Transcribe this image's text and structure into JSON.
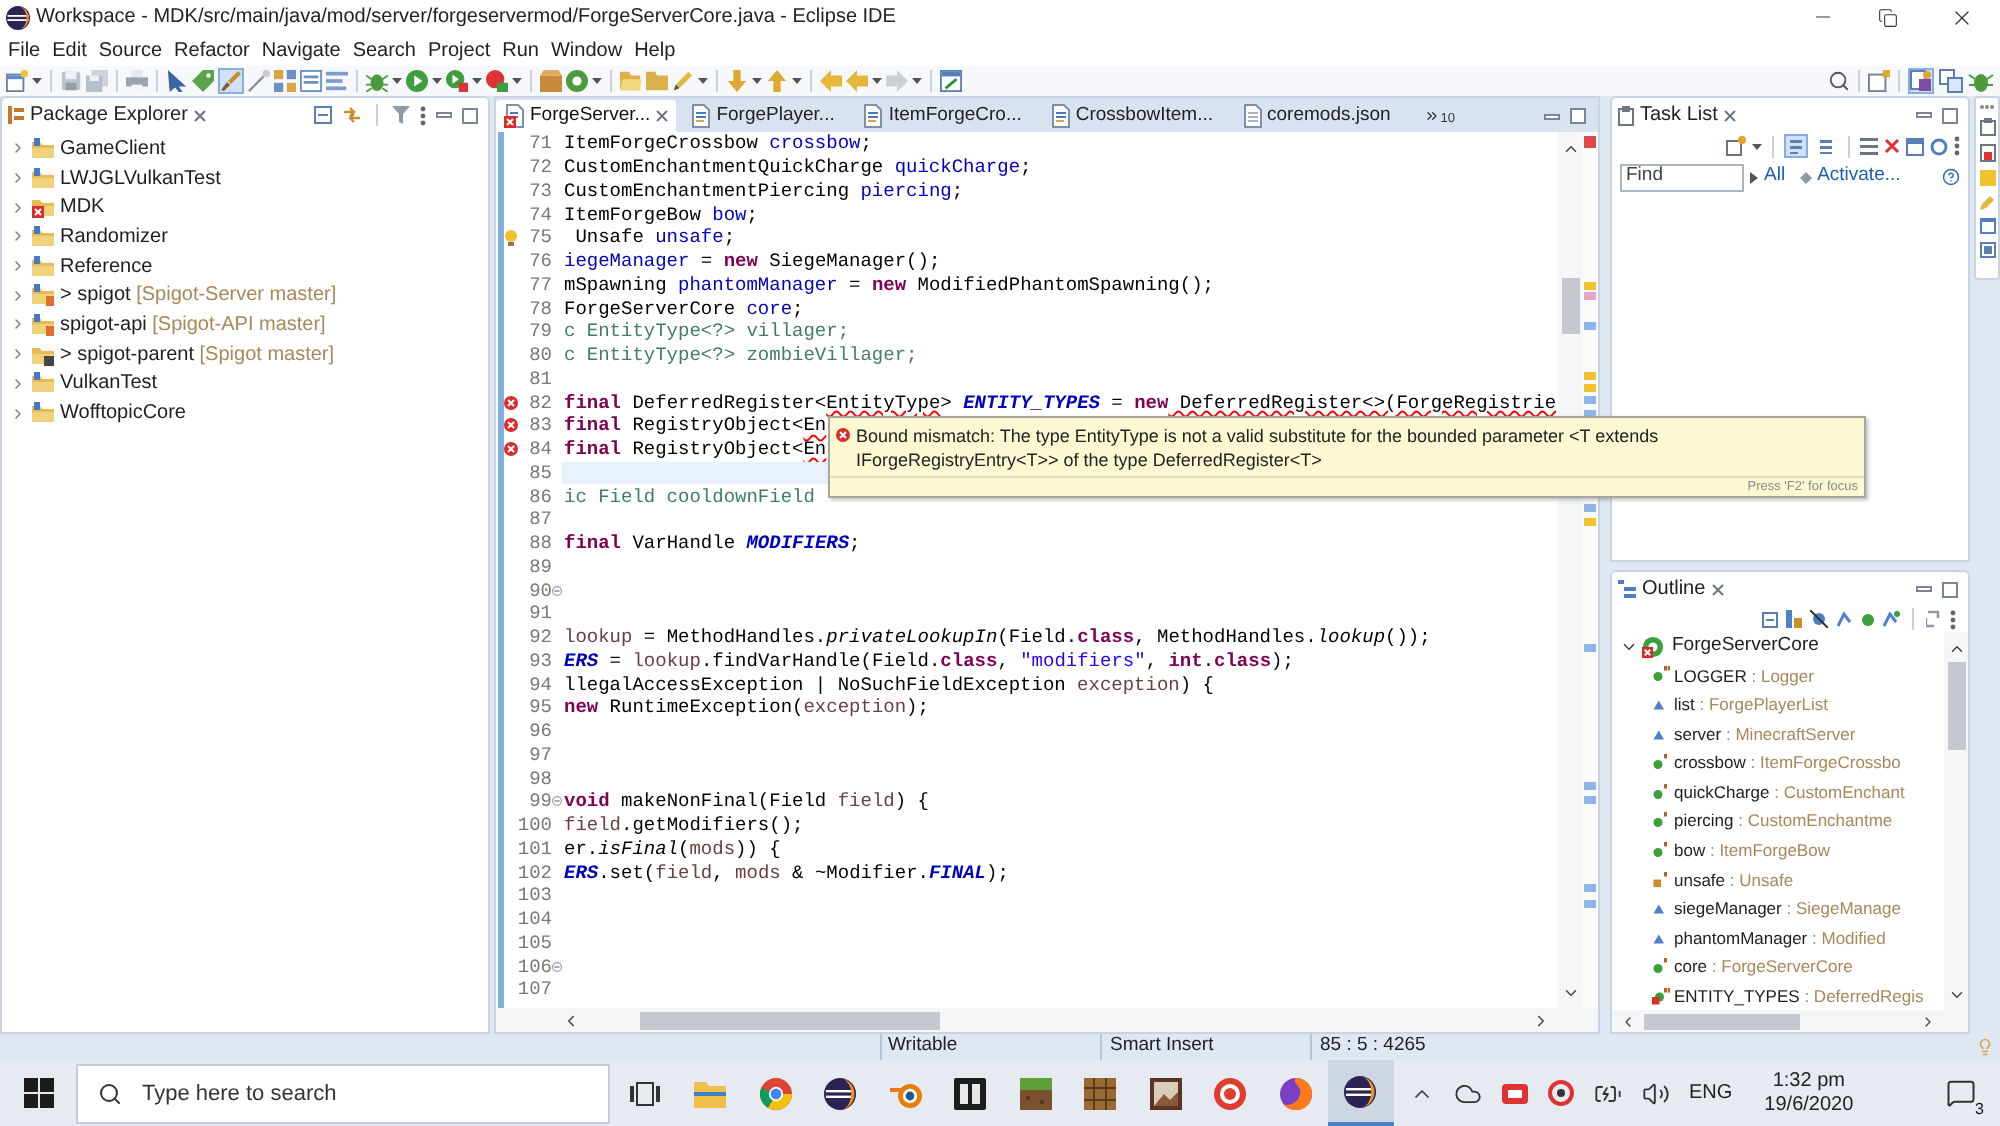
{
  "window": {
    "title": "Workspace - MDK/src/main/java/mod/server/forgeservermod/ForgeServerCore.java - Eclipse IDE"
  },
  "menu": [
    "File",
    "Edit",
    "Source",
    "Refactor",
    "Navigate",
    "Search",
    "Project",
    "Run",
    "Window",
    "Help"
  ],
  "toolbar": {
    "mark_occurrences": {
      "selected": true
    },
    "perspectives": [
      {
        "kind": "java",
        "selected": true
      },
      {
        "kind": "team",
        "selected": false
      },
      {
        "kind": "debug",
        "selected": false
      }
    ]
  },
  "package_explorer": {
    "title": "Package Explorer",
    "items": [
      {
        "name": "GameClient",
        "kind": "project",
        "expanded": false
      },
      {
        "name": "LWJGLVulkanTest",
        "kind": "project",
        "expanded": false
      },
      {
        "name": "MDK",
        "kind": "project-error",
        "expanded": false
      },
      {
        "name": "Randomizer",
        "kind": "project",
        "expanded": false
      },
      {
        "name": "Reference",
        "kind": "project",
        "expanded": false
      },
      {
        "name": "> spigot",
        "repo": "[Spigot-Server master]",
        "kind": "git-project",
        "expanded": false
      },
      {
        "name": "spigot-api",
        "repo": "[Spigot-API master]",
        "kind": "git-project",
        "expanded": false
      },
      {
        "name": "> spigot-parent",
        "repo": "[Spigot master]",
        "kind": "git-folder",
        "expanded": false
      },
      {
        "name": "VulkanTest",
        "kind": "project",
        "expanded": false
      },
      {
        "name": "WofftopicCore",
        "kind": "project",
        "expanded": false
      }
    ]
  },
  "editor": {
    "tabs": [
      {
        "label": "ForgeServer...",
        "kind": "java-error",
        "selected": true
      },
      {
        "label": "ForgePlayer...",
        "kind": "java",
        "selected": false
      },
      {
        "label": "ItemForgeCro...",
        "kind": "java",
        "selected": false
      },
      {
        "label": "CrossbowItem...",
        "kind": "java",
        "selected": false
      },
      {
        "label": "coremods.json",
        "kind": "json",
        "selected": false
      }
    ],
    "hidden_tabs": "10",
    "lines": [
      {
        "number": "71",
        "kind": "code",
        "current": false,
        "segments": [
          {
            "kind": "plain",
            "text": "ItemForgeCrossbow "
          },
          {
            "kind": "field",
            "text": "crossbow"
          },
          {
            "kind": "plain",
            "text": ";"
          }
        ]
      },
      {
        "number": "72",
        "kind": "code",
        "current": false,
        "segments": [
          {
            "kind": "plain",
            "text": "CustomEnchantmentQuickCharge "
          },
          {
            "kind": "field",
            "text": "quickCharge"
          },
          {
            "kind": "plain",
            "text": ";"
          }
        ]
      },
      {
        "number": "73",
        "kind": "code",
        "current": false,
        "segments": [
          {
            "kind": "plain",
            "text": "CustomEnchantmentPiercing "
          },
          {
            "kind": "field",
            "text": "piercing"
          },
          {
            "kind": "plain",
            "text": ";"
          }
        ]
      },
      {
        "number": "74",
        "kind": "code",
        "current": false,
        "segments": [
          {
            "kind": "plain",
            "text": "ItemForgeBow "
          },
          {
            "kind": "field",
            "text": "bow"
          },
          {
            "kind": "plain",
            "text": ";"
          }
        ]
      },
      {
        "number": "75",
        "kind": "warning",
        "current": false,
        "segments": [
          {
            "kind": "plain",
            "text": " Unsafe "
          },
          {
            "kind": "field",
            "text": "unsafe"
          },
          {
            "kind": "plain",
            "text": ";"
          }
        ]
      },
      {
        "number": "76",
        "kind": "code",
        "current": false,
        "segments": [
          {
            "kind": "field",
            "text": "iegeManager"
          },
          {
            "kind": "plain",
            "text": " = "
          },
          {
            "kind": "keyword",
            "text": "new"
          },
          {
            "kind": "plain",
            "text": " SiegeManager();"
          }
        ]
      },
      {
        "number": "77",
        "kind": "code",
        "current": false,
        "segments": [
          {
            "kind": "plain",
            "text": "mSpawning "
          },
          {
            "kind": "field",
            "text": "phantomManager"
          },
          {
            "kind": "plain",
            "text": " = "
          },
          {
            "kind": "keyword",
            "text": "new"
          },
          {
            "kind": "plain",
            "text": " ModifiedPhantomSpawning();"
          }
        ]
      },
      {
        "number": "78",
        "kind": "code",
        "current": false,
        "segments": [
          {
            "kind": "plain",
            "text": "ForgeServerCore "
          },
          {
            "kind": "field",
            "text": "core"
          },
          {
            "kind": "plain",
            "text": ";"
          }
        ]
      },
      {
        "number": "79",
        "kind": "code",
        "current": false,
        "segments": [
          {
            "kind": "comment",
            "text": "c EntityType<?> villager;"
          }
        ]
      },
      {
        "number": "80",
        "kind": "code",
        "current": false,
        "segments": [
          {
            "kind": "comment",
            "text": "c EntityType<?> zombieVillager;"
          }
        ]
      },
      {
        "number": "81",
        "kind": "code",
        "current": false
      },
      {
        "number": "82",
        "kind": "error",
        "current": false,
        "segments": [
          {
            "kind": "keyword",
            "text": "final"
          },
          {
            "kind": "plain",
            "text": " DeferredRegister<"
          },
          {
            "kind": "error",
            "text": "EntityType"
          },
          {
            "kind": "plain",
            "text": "> "
          },
          {
            "kind": "static",
            "text": "ENTITY_TYPES"
          },
          {
            "kind": "plain",
            "text": " = "
          },
          {
            "kind": "keyword",
            "text": "new"
          },
          {
            "kind": "error",
            "text": " DeferredRegister<>(ForgeRegistrie"
          }
        ]
      },
      {
        "number": "83",
        "kind": "error",
        "current": false,
        "segments": [
          {
            "kind": "keyword",
            "text": "final"
          },
          {
            "kind": "plain",
            "text": " RegistryObject<"
          },
          {
            "kind": "error",
            "text": "En"
          }
        ]
      },
      {
        "number": "84",
        "kind": "error",
        "current": false,
        "segments": [
          {
            "kind": "keyword",
            "text": "final"
          },
          {
            "kind": "plain",
            "text": " RegistryObject<"
          },
          {
            "kind": "error",
            "text": "En"
          }
        ]
      },
      {
        "number": "85",
        "kind": "code",
        "current": true
      },
      {
        "number": "86",
        "kind": "code",
        "current": false,
        "segments": [
          {
            "kind": "comment",
            "text": "ic Field cooldownField"
          }
        ]
      },
      {
        "number": "87",
        "kind": "code",
        "current": false
      },
      {
        "number": "88",
        "kind": "code",
        "current": false,
        "segments": [
          {
            "kind": "keyword",
            "text": "final"
          },
          {
            "kind": "plain",
            "text": " VarHandle "
          },
          {
            "kind": "static",
            "text": "MODIFIERS"
          },
          {
            "kind": "plain",
            "text": ";"
          }
        ]
      },
      {
        "number": "89",
        "kind": "code",
        "current": false
      },
      {
        "number": "90",
        "kind": "code",
        "current": false,
        "expanded": true
      },
      {
        "number": "91",
        "kind": "code",
        "current": false
      },
      {
        "number": "92",
        "kind": "code",
        "current": false,
        "segments": [
          {
            "kind": "local",
            "text": "lookup"
          },
          {
            "kind": "plain",
            "text": " = MethodHandles."
          },
          {
            "kind": "static_method",
            "text": "privateLookupIn"
          },
          {
            "kind": "plain",
            "text": "(Field."
          },
          {
            "kind": "keyword",
            "text": "class"
          },
          {
            "kind": "plain",
            "text": ", MethodHandles."
          },
          {
            "kind": "static_method",
            "text": "lookup"
          },
          {
            "kind": "plain",
            "text": "());"
          }
        ]
      },
      {
        "number": "93",
        "kind": "code",
        "current": false,
        "segments": [
          {
            "kind": "static",
            "text": "ERS"
          },
          {
            "kind": "plain",
            "text": " = "
          },
          {
            "kind": "local",
            "text": "lookup"
          },
          {
            "kind": "plain",
            "text": ".findVarHandle(Field."
          },
          {
            "kind": "keyword",
            "text": "class"
          },
          {
            "kind": "plain",
            "text": ", "
          },
          {
            "kind": "string",
            "text": "\"modifiers\""
          },
          {
            "kind": "plain",
            "text": ", "
          },
          {
            "kind": "keyword",
            "text": "int"
          },
          {
            "kind": "plain",
            "text": "."
          },
          {
            "kind": "keyword",
            "text": "class"
          },
          {
            "kind": "plain",
            "text": ");"
          }
        ]
      },
      {
        "number": "94",
        "kind": "code",
        "current": false,
        "segments": [
          {
            "kind": "plain",
            "text": "llegalAccessException | NoSuchFieldException "
          },
          {
            "kind": "local",
            "text": "exception"
          },
          {
            "kind": "plain",
            "text": ") {"
          }
        ]
      },
      {
        "number": "95",
        "kind": "code",
        "current": false,
        "segments": [
          {
            "kind": "keyword",
            "text": "new"
          },
          {
            "kind": "plain",
            "text": " RuntimeException("
          },
          {
            "kind": "local",
            "text": "exception"
          },
          {
            "kind": "plain",
            "text": ");"
          }
        ]
      },
      {
        "number": "96",
        "kind": "code",
        "current": false
      },
      {
        "number": "97",
        "kind": "code",
        "current": false
      },
      {
        "number": "98",
        "kind": "code",
        "current": false
      },
      {
        "number": "99",
        "kind": "code",
        "current": false,
        "expanded": true,
        "segments": [
          {
            "kind": "keyword",
            "text": "void"
          },
          {
            "kind": "plain",
            "text": " makeNonFinal(Field "
          },
          {
            "kind": "local",
            "text": "field"
          },
          {
            "kind": "plain",
            "text": ") {"
          }
        ]
      },
      {
        "number": "100",
        "kind": "code",
        "current": false,
        "segments": [
          {
            "kind": "local",
            "text": "field"
          },
          {
            "kind": "plain",
            "text": ".getModifiers();"
          }
        ]
      },
      {
        "number": "101",
        "kind": "code",
        "current": false,
        "segments": [
          {
            "kind": "plain",
            "text": "er."
          },
          {
            "kind": "static_method",
            "text": "isFinal"
          },
          {
            "kind": "plain",
            "text": "("
          },
          {
            "kind": "local",
            "text": "mods"
          },
          {
            "kind": "plain",
            "text": ")) {"
          }
        ]
      },
      {
        "number": "102",
        "kind": "code",
        "current": false,
        "segments": [
          {
            "kind": "static",
            "text": "ERS"
          },
          {
            "kind": "plain",
            "text": ".set("
          },
          {
            "kind": "local",
            "text": "field"
          },
          {
            "kind": "plain",
            "text": ", "
          },
          {
            "kind": "local",
            "text": "mods"
          },
          {
            "kind": "plain",
            "text": " & ~Modifier."
          },
          {
            "kind": "static",
            "text": "FINAL"
          },
          {
            "kind": "plain",
            "text": ");"
          }
        ]
      },
      {
        "number": "103",
        "kind": "code",
        "current": false
      },
      {
        "number": "104",
        "kind": "code",
        "current": false
      },
      {
        "number": "105",
        "kind": "code",
        "current": false
      },
      {
        "number": "106",
        "kind": "code",
        "current": false,
        "expanded": true
      },
      {
        "number": "107",
        "kind": "code",
        "current": false
      }
    ],
    "tooltip": {
      "message_lines": [
        "Bound mismatch: The type EntityType is not a valid substitute for the bounded parameter <T extends",
        "IForgeRegistryEntry<T>> of the type DeferredRegister<T>"
      ],
      "hint": "Press 'F2' for focus"
    }
  },
  "task_list": {
    "title": "Task List",
    "toggles": [
      {
        "selected": true
      },
      {
        "selected": false
      }
    ],
    "find": {
      "placeholder": "Find"
    },
    "links": [
      "All",
      "Activate..."
    ]
  },
  "outline": {
    "title": "Outline",
    "root": {
      "name": "ForgeServerCore",
      "kind": "class-error",
      "expanded": true,
      "children": [
        {
          "name": "LOGGER",
          "type": ": Logger",
          "kind": "public-static-final"
        },
        {
          "name": "list",
          "type": ": ForgePlayerList",
          "kind": "package"
        },
        {
          "name": "server",
          "type": ": MinecraftServer",
          "kind": "package"
        },
        {
          "name": "crossbow",
          "type": ": ItemForgeCrossbo",
          "kind": "public-static"
        },
        {
          "name": "quickCharge",
          "type": ": CustomEnchant",
          "kind": "public-static"
        },
        {
          "name": "piercing",
          "type": ": CustomEnchantme",
          "kind": "public-static"
        },
        {
          "name": "bow",
          "type": ": ItemForgeBow",
          "kind": "public-static"
        },
        {
          "name": "unsafe",
          "type": ": Unsafe",
          "kind": "private-static"
        },
        {
          "name": "siegeManager",
          "type": ": SiegeManage",
          "kind": "package"
        },
        {
          "name": "phantomManager",
          "type": ": Modified",
          "kind": "package"
        },
        {
          "name": "core",
          "type": ": ForgeServerCore",
          "kind": "public-static"
        },
        {
          "name": "ENTITY_TYPES",
          "type": ": DeferredRegis",
          "kind": "error-static-final"
        }
      ]
    }
  },
  "status_bar": {
    "mode": "Writable",
    "insert_mode": "Smart Insert",
    "position": "85 : 5 : 4265"
  },
  "taskbar": {
    "search": {
      "placeholder": "Type here to search"
    },
    "apps": [
      {
        "kind": "folder",
        "selected": false
      },
      {
        "kind": "ring-browser",
        "selected": false
      },
      {
        "kind": "sphere",
        "selected": false
      },
      {
        "kind": "ring-dot",
        "selected": false
      },
      {
        "kind": "dark-tile",
        "selected": false
      },
      {
        "kind": "grass-block",
        "selected": false
      },
      {
        "kind": "crate",
        "selected": false
      },
      {
        "kind": "picture",
        "selected": false
      },
      {
        "kind": "swirl",
        "selected": false
      },
      {
        "kind": "flame-globe",
        "selected": false
      },
      {
        "kind": "sphere",
        "selected": true
      }
    ],
    "language": "ENG",
    "time": "1:32 pm",
    "date": "19/6/2020",
    "notifications": "3"
  }
}
